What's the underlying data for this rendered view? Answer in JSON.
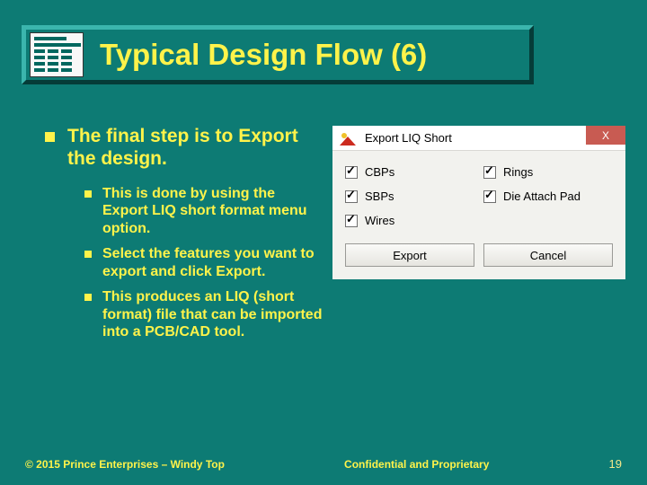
{
  "slide": {
    "title": "Typical Design Flow (6)",
    "bullet_main": "The final step is to Export the design.",
    "sub_bullets": [
      "This is done by using the Export LIQ short format menu option.",
      "Select the features you want to export and click Export.",
      "This produces an LIQ (short format) file that can be imported into a PCB/CAD tool."
    ]
  },
  "dialog": {
    "title": "Export LIQ Short",
    "close_glyph": "X",
    "checkboxes": [
      {
        "label": "CBPs",
        "checked": true
      },
      {
        "label": "Rings",
        "checked": true
      },
      {
        "label": "SBPs",
        "checked": true
      },
      {
        "label": "Die Attach Pad",
        "checked": true
      },
      {
        "label": "Wires",
        "checked": true
      }
    ],
    "buttons": {
      "export": "Export",
      "cancel": "Cancel"
    }
  },
  "footer": {
    "left": "© 2015 Prince Enterprises – Windy Top",
    "center": "Confidential and Proprietary",
    "page": "19"
  }
}
